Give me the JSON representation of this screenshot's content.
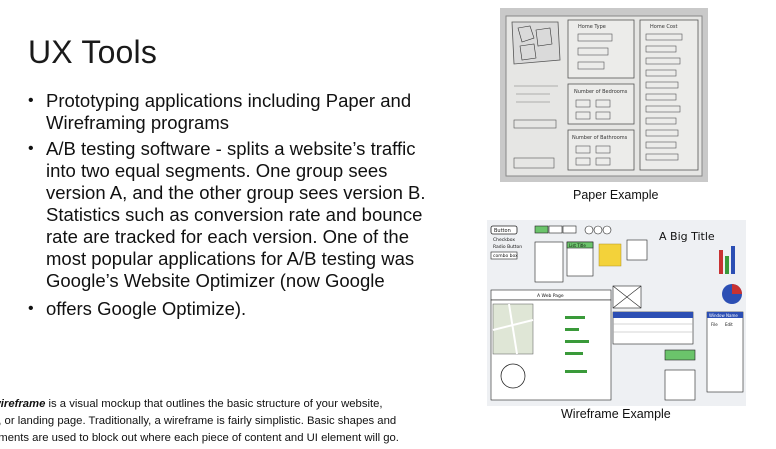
{
  "slide": {
    "title": "UX Tools",
    "bullets": [
      "Prototyping applications including Paper and Wireframing programs",
      "A/B testing software - splits a website’s traffic into two equal segments. One group sees version A, and the other group sees version B. Statistics such as conversion rate and bounce rate are tracked for each version. One of the most popular applications for A/B testing was Google’s Website Optimizer (now Google",
      "offers Google Optimize)."
    ],
    "bullet_glyph": "•",
    "footnote": {
      "line1_bold": "wireframe",
      "line1_rest": " is a visual mockup that outlines the basic structure of your website,",
      "line2": "p, or landing page. Traditionally, a wireframe is fairly simplistic. Basic shapes and",
      "line3": "ements are used to block out where each piece of content and UI element will go."
    }
  },
  "images": {
    "paper_caption": "Paper Example",
    "wireframe_caption": "Wireframe Example",
    "paper_labels": {
      "home_type": "Home Type",
      "home_cost": "Home Cost",
      "bedrooms": "Number of Bedrooms",
      "bathrooms": "Number of Bathrooms"
    },
    "wire_labels": {
      "button": "Button",
      "big_title": "A Big Title",
      "checkbox": "Checkbox",
      "radio": "Radio Button",
      "combo": "combo box",
      "list_title": "List Title",
      "web_page": "A Web Page",
      "window": "Window Name",
      "file": "File",
      "edit": "Edit"
    },
    "accent_colors": {
      "sticky": "#f3d23a",
      "green": "#3a9a3a",
      "red": "#c83232",
      "blue": "#2c4fb4"
    }
  }
}
